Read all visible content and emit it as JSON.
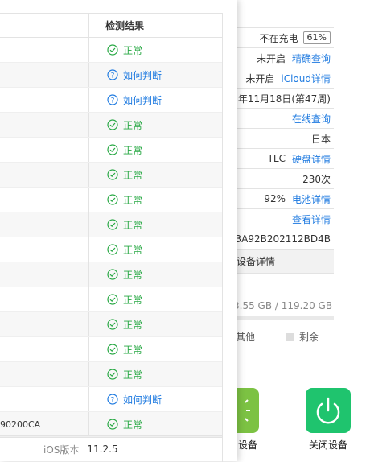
{
  "device_info": {
    "rows": [
      {
        "value": "不在充电",
        "badge": "61%",
        "link": ""
      },
      {
        "value": "未开启",
        "badge": "",
        "link": "精确查询"
      },
      {
        "value": "未开启",
        "badge": "",
        "link": "iCloud详情"
      },
      {
        "value": "年11月18日(第47周)",
        "badge": "",
        "link": ""
      },
      {
        "value": "",
        "badge": "",
        "link": "在线查询"
      },
      {
        "value": "日本",
        "badge": "",
        "link": ""
      },
      {
        "value": "TLC",
        "badge": "",
        "link": "硬盘详情"
      },
      {
        "value": "230次",
        "badge": "",
        "link": ""
      },
      {
        "value": "92%",
        "badge": "",
        "link": "电池详情"
      },
      {
        "value": "",
        "badge": "",
        "link": "查看详情"
      },
      {
        "value": "3A92B202112BD4B",
        "badge": "",
        "link": ""
      }
    ],
    "more_details": "设备详情",
    "storage_text": "3.55 GB / 119.20 GB",
    "legend_other": "其他",
    "legend_free": "剩余"
  },
  "actions": {
    "left_label": "设备",
    "shutdown_label": "关闭设备",
    "left_color": "#7cc243",
    "shutdown_color": "#1fc46e"
  },
  "check_table": {
    "header": "检测结果",
    "rows": [
      {
        "name": "",
        "result": "正常",
        "status": "ok"
      },
      {
        "name": "",
        "result": "如何判断",
        "status": "how"
      },
      {
        "name": "",
        "result": "如何判断",
        "status": "how"
      },
      {
        "name": "",
        "result": "正常",
        "status": "ok"
      },
      {
        "name": "",
        "result": "正常",
        "status": "ok"
      },
      {
        "name": "",
        "result": "正常",
        "status": "ok"
      },
      {
        "name": "",
        "result": "正常",
        "status": "ok"
      },
      {
        "name": "",
        "result": "正常",
        "status": "ok"
      },
      {
        "name": "",
        "result": "正常",
        "status": "ok"
      },
      {
        "name": "",
        "result": "正常",
        "status": "ok"
      },
      {
        "name": "",
        "result": "正常",
        "status": "ok"
      },
      {
        "name": "",
        "result": "正常",
        "status": "ok"
      },
      {
        "name": "",
        "result": "正常",
        "status": "ok"
      },
      {
        "name": "",
        "result": "正常",
        "status": "ok"
      },
      {
        "name": "",
        "result": "如何判断",
        "status": "how"
      },
      {
        "name": "90200CA",
        "result": "正常",
        "status": "ok"
      }
    ]
  },
  "footer": {
    "label": "iOS版本",
    "value": "11.2.5"
  },
  "colors": {
    "ok": "#27a843",
    "link": "#1e7ae0"
  }
}
